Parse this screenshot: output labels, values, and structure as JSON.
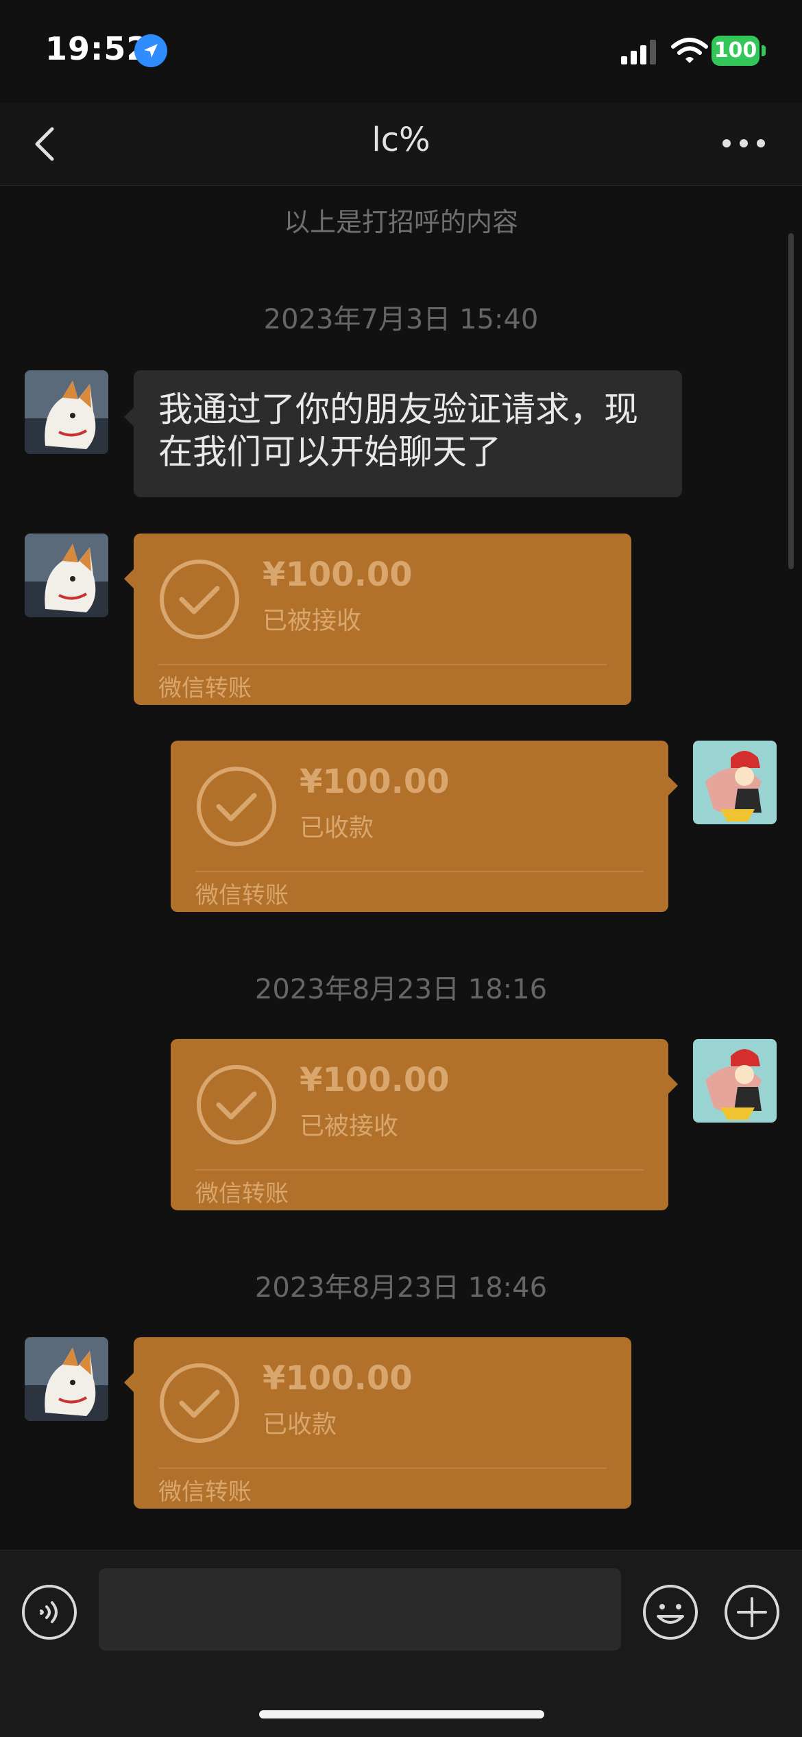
{
  "status_bar": {
    "time": "19:52",
    "battery": "100"
  },
  "header": {
    "title": "lc%"
  },
  "chat": {
    "system_note": "以上是打招呼的内容",
    "timestamps": [
      "2023年7月3日 15:40",
      "2023年8月23日 18:16",
      "2023年8月23日 18:46"
    ],
    "text_message": "我通过了你的朋友验证请求，现在我们可以开始聊天了",
    "transfers": [
      {
        "side": "left",
        "amount": "¥100.00",
        "status": "已被接收",
        "label": "微信转账"
      },
      {
        "side": "right",
        "amount": "¥100.00",
        "status": "已收款",
        "label": "微信转账"
      },
      {
        "side": "right",
        "amount": "¥100.00",
        "status": "已被接收",
        "label": "微信转账"
      },
      {
        "side": "left",
        "amount": "¥100.00",
        "status": "已收款",
        "label": "微信转账"
      }
    ]
  },
  "input": {
    "value": ""
  },
  "colors": {
    "background": "#111111",
    "transfer_bubble": "#b1712b",
    "text_bubble": "#2c2c2c",
    "battery": "#33c759",
    "location": "#2f8cff"
  },
  "icons": [
    "location-arrow-icon",
    "signal-icon",
    "wifi-icon",
    "battery-icon",
    "back-chevron-icon",
    "more-dots-icon",
    "check-circle-icon",
    "voice-icon",
    "emoji-icon",
    "plus-icon"
  ]
}
